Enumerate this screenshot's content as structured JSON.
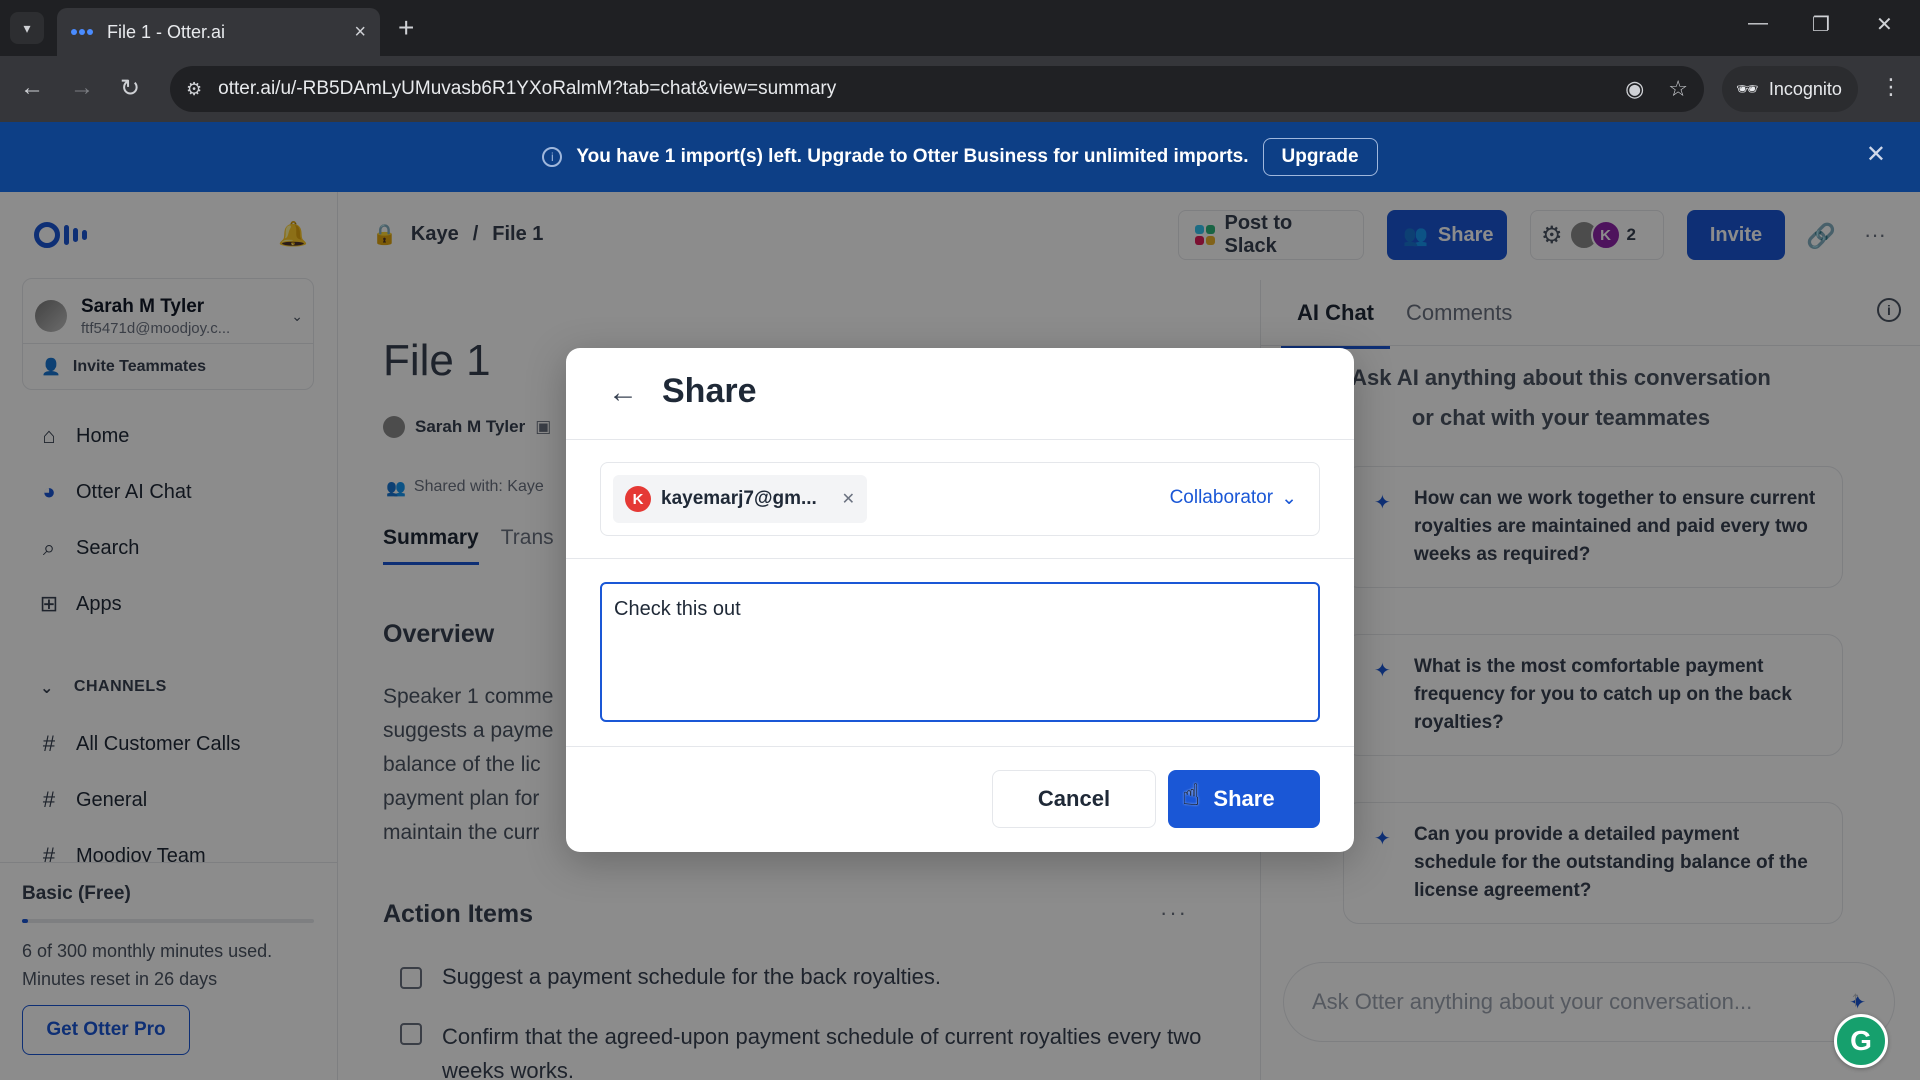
{
  "browser": {
    "tab_title": "File 1 - Otter.ai",
    "url": "otter.ai/u/-RB5DAmLyUMuvasb6R1YXoRalmM?tab=chat&view=summary",
    "incognito_label": "Incognito"
  },
  "banner": {
    "text_start": "You have 1 import(s) left. Upgrade to ",
    "text_brand": "Otter Business",
    "text_end": " for unlimited imports.",
    "upgrade_label": "Upgrade"
  },
  "sidebar": {
    "user": {
      "name": "Sarah M Tyler",
      "email": "ftf5471d@moodjoy.c..."
    },
    "invite_label": "Invite Teammates",
    "nav": [
      {
        "label": "Home",
        "icon": "home-icon"
      },
      {
        "label": "Otter AI Chat",
        "icon": "otter-chat-icon"
      },
      {
        "label": "Search",
        "icon": "search-icon"
      },
      {
        "label": "Apps",
        "icon": "apps-icon"
      }
    ],
    "channels_header": "CHANNELS",
    "channels": [
      "All Customer Calls",
      "General",
      "Moodjoy Team"
    ],
    "plan": {
      "name": "Basic (Free)",
      "usage_line1": "6 of 300 monthly minutes used.",
      "usage_line2": "Minutes reset in 26 days",
      "usage_fraction": 0.02,
      "cta": "Get Otter Pro"
    }
  },
  "topbar": {
    "breadcrumb_owner": "Kaye",
    "breadcrumb_sep": "/",
    "breadcrumb_file": "File 1",
    "post_to_slack": "Post to Slack",
    "share_label": "Share",
    "collab_initial": "K",
    "collab_count": "2",
    "invite_label": "Invite"
  },
  "doc": {
    "title": "File 1",
    "author": "Sarah M Tyler",
    "shared_with": "Shared with: Kaye",
    "tabs": [
      "Summary",
      "Trans"
    ],
    "overview_heading": "Overview",
    "overview_lines": [
      "Speaker 1 comme",
      "suggests a payme",
      "balance of the lic",
      "payment plan for",
      "maintain the curr"
    ],
    "action_heading": "Action Items",
    "actions": [
      "Suggest a payment schedule for the back royalties.",
      "Confirm that the agreed-upon payment schedule of current royalties every two weeks works."
    ]
  },
  "right_panel": {
    "tabs": [
      "AI Chat",
      "Comments"
    ],
    "prompt": "Ask AI anything about this conversation or chat with your teammates",
    "suggestions": [
      "How can we work together to ensure current royalties are maintained and paid every two weeks as required?",
      "What is the most comfortable payment frequency for you to catch up on the back royalties?",
      "Can you provide a detailed payment schedule for the outstanding balance of the license agreement?"
    ],
    "input_placeholder": "Ask Otter anything about your conversation..."
  },
  "modal": {
    "title": "Share",
    "recipient_initial": "K",
    "recipient": "kayemarj7@gm...",
    "role": "Collaborator",
    "message": "Check this out",
    "cancel_label": "Cancel",
    "share_label": "Share"
  },
  "colors": {
    "accent": "#1a57d6",
    "banner_bg": "#0d3f86",
    "chip_avatar": "#e53935",
    "grammarly": "#16a06d"
  }
}
